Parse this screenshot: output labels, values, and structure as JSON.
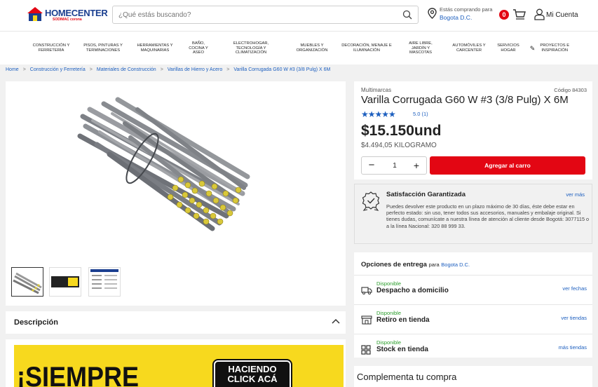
{
  "header": {
    "logo_text": "HOMECENTER",
    "logo_sub": "SODIMAC corona",
    "search_placeholder": "¿Qué estás buscando?",
    "location_label": "Estás comprando para",
    "location_city": "Bogota D.C.",
    "cart_count": "0",
    "account_label": "Mi Cuenta"
  },
  "categories": [
    {
      "label": "CONSTRUCCIÓN Y FERRETERÍA"
    },
    {
      "label": "PISOS, PINTURAS Y TERMINACIONES"
    },
    {
      "label": "HERRAMIENTAS Y MAQUINARIAS"
    },
    {
      "label": "BAÑO, COCINA Y ASEO"
    },
    {
      "label": "ELECTROHOGAR, TECNOLOGÍA Y CLIMATIZACIÓN"
    },
    {
      "label": "MUEBLES Y ORGANIZACIÓN"
    },
    {
      "label": "DECORACIÓN, MENAJE E ILUMINACIÓN"
    },
    {
      "label": "AIRE LIBRE, JARDÍN Y MASCOTAS"
    },
    {
      "label": "AUTOMÓVILES Y CARCENTER"
    },
    {
      "label": "SERVICIOS HOGAR"
    },
    {
      "label": "PROYECTOS E INSPIRACIÓN"
    }
  ],
  "breadcrumb": [
    "Home",
    "Construcción y Ferretería",
    "Materiales de Construcción",
    "Varillas de Hierro y Acero",
    "Varilla Corrugada G60 W #3 (3/8 Pulg) X 6M"
  ],
  "product": {
    "brand": "Multimarcas",
    "code": "Código 84303",
    "title": "Varilla Corrugada G60 W #3 (3/8 Pulg) X 6M",
    "rating_text": "5.0 (1)",
    "rating": 5,
    "price": "$15.150und",
    "unit_price": "$4.494,05 KILOGRAMO",
    "quantity": "1",
    "add_to_cart": "Agregar al carro"
  },
  "guarantee": {
    "title": "Satisfacción Garantizada",
    "link": "ver más",
    "text": "Puedes devolver este producto en un plazo máximo de 30 días, éste debe estar en perfecto estado: sin uso, tener todos sus accesorios, manuales y embalaje original. Si tienes dudas, comunícate a nuestra línea de atención al cliente desde Bogotá: 3077115 o a la línea Nacional: 320 88 999 33."
  },
  "delivery": {
    "heading": "Opciones de entrega",
    "para": "para",
    "city": "Bogota D.C.",
    "options": [
      {
        "status": "Disponible",
        "label": "Despacho a domicilio",
        "link": "ver fechas"
      },
      {
        "status": "Disponible",
        "label": "Retiro en tienda",
        "link": "ver tiendas"
      },
      {
        "status": "Disponible",
        "label": "Stock en tienda",
        "link": "más tiendas"
      }
    ]
  },
  "description": {
    "title": "Descripción",
    "banner_big": "¡SIEMPRE",
    "banner_button": "HACIENDO CLICK ACÁ"
  },
  "complement": {
    "title": "Complementa tu compra"
  },
  "colors": {
    "brand_blue": "#1b3f90",
    "accent_red": "#e30613",
    "link_blue": "#1d5fbf",
    "banner_yellow": "#f7d91e"
  }
}
